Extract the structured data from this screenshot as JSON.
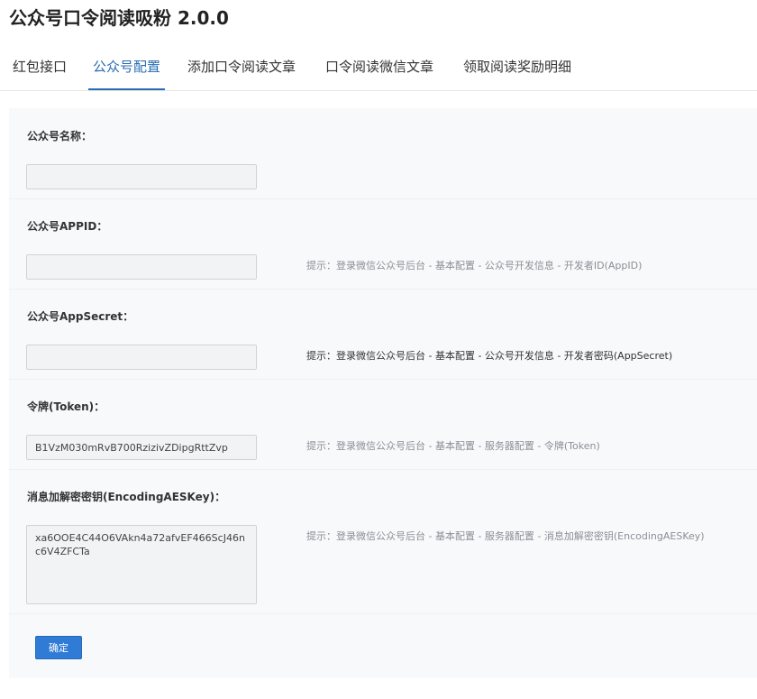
{
  "app": {
    "title": "公众号口令阅读吸粉 2.0.0"
  },
  "tabs": [
    {
      "label": "红包接口",
      "active": false
    },
    {
      "label": "公众号配置",
      "active": true
    },
    {
      "label": "添加口令阅读文章",
      "active": false
    },
    {
      "label": "口令阅读微信文章",
      "active": false
    },
    {
      "label": "领取阅读奖励明细",
      "active": false
    }
  ],
  "form": {
    "fields": [
      {
        "label": "公众号名称：",
        "value": "",
        "hint": ""
      },
      {
        "label": "公众号APPID：",
        "value": "",
        "hint": "提示：登录微信公众号后台 - 基本配置 - 公众号开发信息 - 开发者ID(AppID)"
      },
      {
        "label": "公众号AppSecret：",
        "value": "",
        "hint": "提示：登录微信公众号后台 - 基本配置 - 公众号开发信息 - 开发者密码(AppSecret)"
      },
      {
        "label": "令牌(Token)：",
        "value": "B1VzM030mRvB700RzizivZDipgRttZvp",
        "hint": "提示：登录微信公众号后台 - 基本配置 - 服务器配置 - 令牌(Token)"
      },
      {
        "label": "消息加解密密钥(EncodingAESKey)：",
        "value": "xa6OOE4C44O6VAkn4a72afvEF466ScJ46nc6V4ZFCTa",
        "hint": "提示：登录微信公众号后台 - 基本配置 - 服务器配置 - 消息加解密密钥(EncodingAESKey)"
      }
    ],
    "submit_label": "确定"
  },
  "colors": {
    "accent": "#2a6db5",
    "button": "#2f7bd6",
    "panel_bg": "#f8f9fb"
  }
}
